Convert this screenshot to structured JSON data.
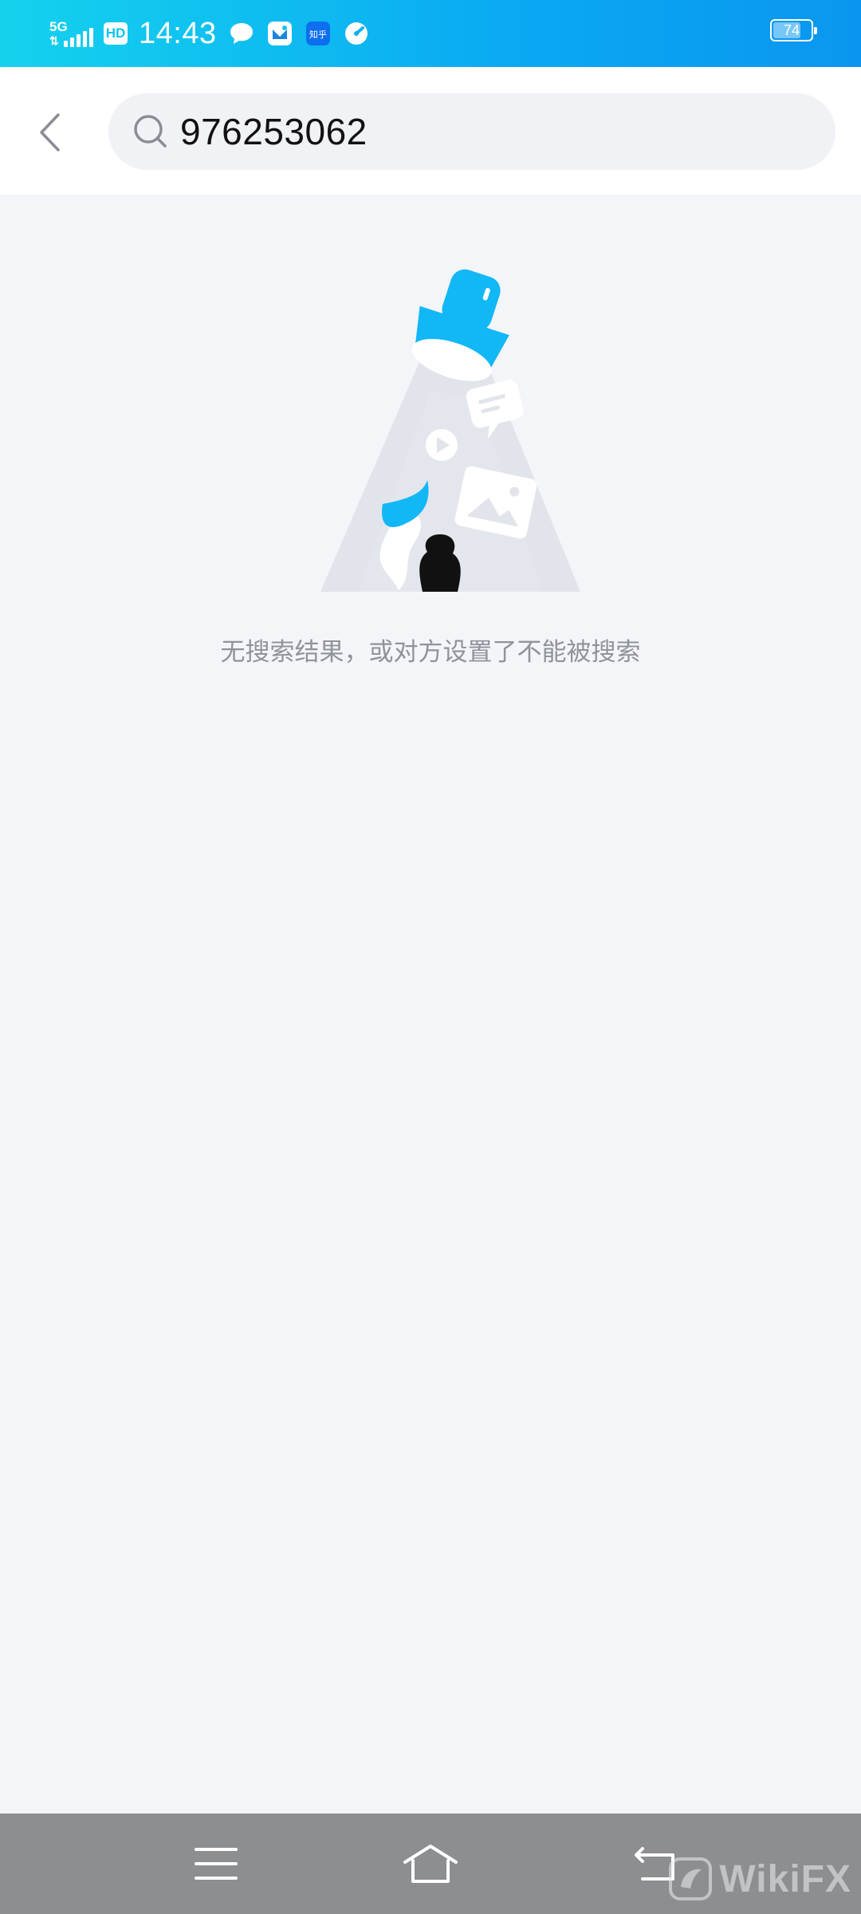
{
  "status_bar": {
    "network": "5G",
    "hd": "HD",
    "time": "14:43",
    "notification_icons": [
      "chat-bubble-icon",
      "mail-app-icon",
      "zhihu-app-icon",
      "speed-app-icon"
    ],
    "zhihu_label": "知乎",
    "battery_level": "74",
    "battery_fraction": 0.74
  },
  "header": {
    "search_value": "976253062"
  },
  "empty_state": {
    "message": "无搜索结果，或对方设置了不能被搜索",
    "illustration": "flashlight-search-icon"
  },
  "nav_bar": {
    "buttons": [
      "menu-icon",
      "home-icon",
      "back-icon"
    ]
  },
  "watermark": {
    "text": "WikiFX"
  },
  "colors": {
    "status_bar_start": "#14d2ee",
    "status_bar_end": "#0a96f0",
    "page_background": "#f3f5f9",
    "search_background": "#f1f2f6",
    "accent_blue": "#12b7f5",
    "message_text": "#8f939a",
    "nav_bar": "#8c8e90"
  }
}
